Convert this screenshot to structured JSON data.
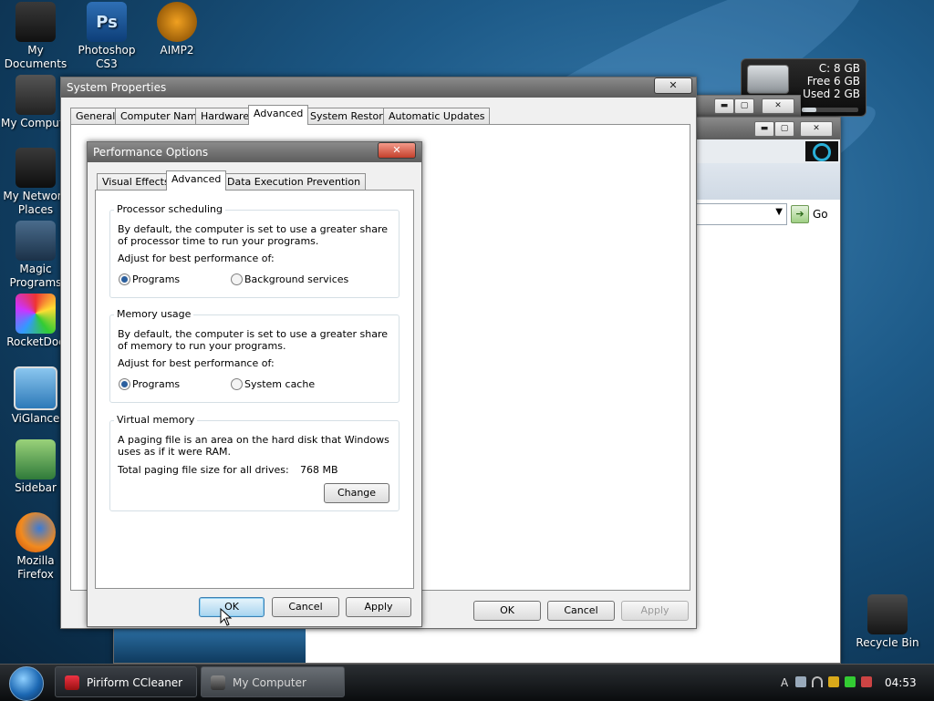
{
  "desktop": {
    "icons": [
      {
        "label": "My Documents",
        "glyph": ""
      },
      {
        "label": "Photoshop CS3",
        "glyph": "Ps"
      },
      {
        "label": "AIMP2",
        "glyph": ""
      },
      {
        "label": "My Compute",
        "glyph": ""
      },
      {
        "label": "My Network Places",
        "glyph": ""
      },
      {
        "label": "Magic Programs",
        "glyph": ""
      },
      {
        "label": "RocketDoc",
        "glyph": ""
      },
      {
        "label": "ViGlance",
        "glyph": ""
      },
      {
        "label": "Sidebar",
        "glyph": ""
      },
      {
        "label": "Mozilla Firefox",
        "glyph": ""
      },
      {
        "label": "Recycle Bin",
        "glyph": ""
      }
    ]
  },
  "gadget": {
    "c": "C:  8 GB",
    "free": "Free 6 GB",
    "used": "Used 2 GB",
    "used_fraction": 0.25
  },
  "bg_window": {
    "go_label": "Go"
  },
  "system_properties": {
    "title": "System Properties",
    "tabs": [
      "General",
      "Computer Name",
      "Hardware",
      "Advanced",
      "System Restore",
      "Automatic Updates"
    ],
    "active_tab": "Advanced",
    "ok": "OK",
    "cancel": "Cancel",
    "apply": "Apply"
  },
  "performance": {
    "title": "Performance Options",
    "tabs": [
      "Visual Effects",
      "Advanced",
      "Data Execution Prevention"
    ],
    "processor": {
      "title": "Processor scheduling",
      "desc": "By default, the computer is set to use a greater share of processor time to run your programs.",
      "adjust": "Adjust for best performance of:",
      "opt1": "Programs",
      "opt2": "Background services"
    },
    "memory": {
      "title": "Memory usage",
      "desc": "By default, the computer is set to use a greater share of memory to run your programs.",
      "adjust": "Adjust for best performance of:",
      "opt1": "Programs",
      "opt2": "System cache"
    },
    "virtual": {
      "title": "Virtual memory",
      "desc": "A paging file is an area on the hard disk that Windows uses as if it were RAM.",
      "total_label": "Total paging file size for all drives:",
      "total_value": "768 MB",
      "change": "Change"
    },
    "ok": "OK",
    "cancel": "Cancel",
    "apply": "Apply"
  },
  "taskbar": {
    "items": [
      "Piriform CCleaner",
      "My Computer"
    ],
    "tray_letter": "A",
    "clock": "04:53"
  },
  "colors": {
    "accent": "#3c7fb1",
    "radio_dot": "#2b5f9e"
  }
}
